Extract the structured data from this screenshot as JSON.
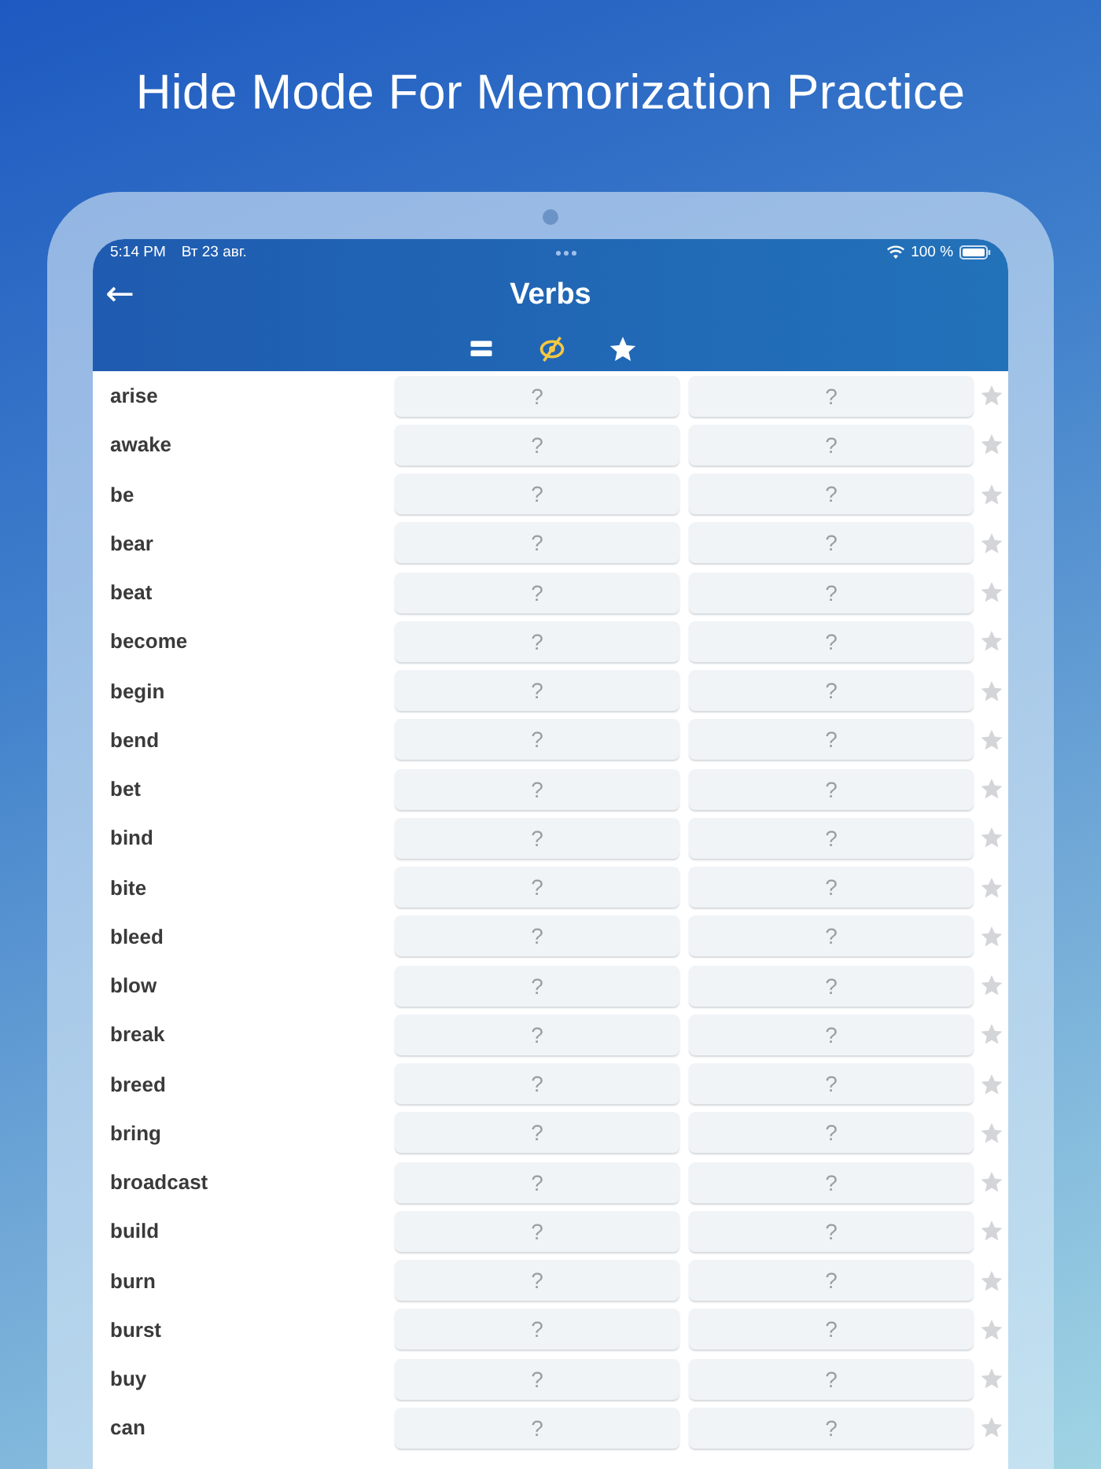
{
  "headline": "Hide Mode For Memorization Practice",
  "status_bar": {
    "time": "5:14 PM",
    "date": "Вт 23 авг.",
    "battery": "100 %"
  },
  "nav": {
    "back": "←",
    "title": "Verbs"
  },
  "modes": [
    {
      "kind": "list",
      "selected": false
    },
    {
      "kind": "hide",
      "selected": true
    },
    {
      "kind": "favorites",
      "selected": false
    }
  ],
  "rows": [
    {
      "word": "arise",
      "cells": [
        "?",
        "?"
      ],
      "starred": false
    },
    {
      "word": "awake",
      "cells": [
        "?",
        "?"
      ],
      "starred": false
    },
    {
      "word": "be",
      "cells": [
        "?",
        "?"
      ],
      "starred": false
    },
    {
      "word": "bear",
      "cells": [
        "?",
        "?"
      ],
      "starred": false
    },
    {
      "word": "beat",
      "cells": [
        "?",
        "?"
      ],
      "starred": false
    },
    {
      "word": "become",
      "cells": [
        "?",
        "?"
      ],
      "starred": false
    },
    {
      "word": "begin",
      "cells": [
        "?",
        "?"
      ],
      "starred": false
    },
    {
      "word": "bend",
      "cells": [
        "?",
        "?"
      ],
      "starred": false
    },
    {
      "word": "bet",
      "cells": [
        "?",
        "?"
      ],
      "starred": false
    },
    {
      "word": "bind",
      "cells": [
        "?",
        "?"
      ],
      "starred": false
    },
    {
      "word": "bite",
      "cells": [
        "?",
        "?"
      ],
      "starred": false
    },
    {
      "word": "bleed",
      "cells": [
        "?",
        "?"
      ],
      "starred": false
    },
    {
      "word": "blow",
      "cells": [
        "?",
        "?"
      ],
      "starred": false
    },
    {
      "word": "break",
      "cells": [
        "?",
        "?"
      ],
      "starred": false
    },
    {
      "word": "breed",
      "cells": [
        "?",
        "?"
      ],
      "starred": false
    },
    {
      "word": "bring",
      "cells": [
        "?",
        "?"
      ],
      "starred": false
    },
    {
      "word": "broadcast",
      "cells": [
        "?",
        "?"
      ],
      "starred": false
    },
    {
      "word": "build",
      "cells": [
        "?",
        "?"
      ],
      "starred": false
    },
    {
      "word": "burn",
      "cells": [
        "?",
        "?"
      ],
      "starred": false
    },
    {
      "word": "burst",
      "cells": [
        "?",
        "?"
      ],
      "starred": false
    },
    {
      "word": "buy",
      "cells": [
        "?",
        "?"
      ],
      "starred": false
    },
    {
      "word": "can",
      "cells": [
        "?",
        "?"
      ],
      "starred": false
    }
  ]
}
